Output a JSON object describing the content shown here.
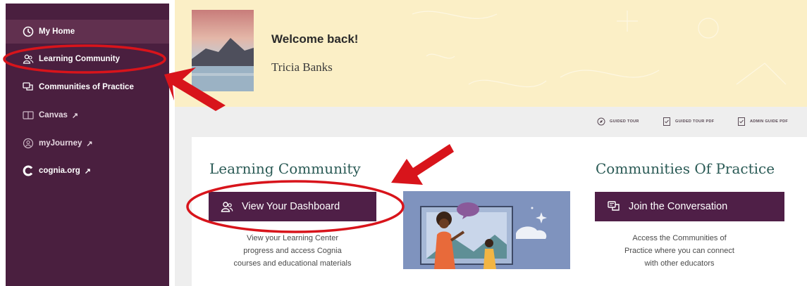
{
  "sidebar": {
    "items": [
      {
        "label": "My Home",
        "icon": "home-dial-icon",
        "external": false,
        "active": true
      },
      {
        "label": "Learning Community",
        "icon": "people-icon",
        "external": false,
        "active": false
      },
      {
        "label": "Communities of Practice",
        "icon": "chat-bubbles-icon",
        "external": false,
        "active": false
      },
      {
        "label": "Canvas",
        "icon": "book-icon",
        "external": true,
        "active": false
      },
      {
        "label": "myJourney",
        "icon": "journey-icon",
        "external": true,
        "active": false
      },
      {
        "label": "cognia.org",
        "icon": "cognia-logo-icon",
        "external": true,
        "active": false
      }
    ],
    "external_glyph": "↗"
  },
  "welcome": {
    "title": "Welcome back!",
    "name": "Tricia Banks"
  },
  "toolbar": {
    "items": [
      {
        "label": "GUIDED TOUR",
        "icon": "compass-icon"
      },
      {
        "label": "GUIDED TOUR PDF",
        "icon": "pdf-doc-icon"
      },
      {
        "label": "ADMIN GUIDE PDF",
        "icon": "pdf-doc-icon"
      }
    ]
  },
  "learning_community": {
    "title": "Learning Community",
    "button": "View Your Dashboard",
    "description_lines": [
      "View your Learning Center",
      "progress and access Cognia",
      "courses and educational materials"
    ]
  },
  "communities_of_practice": {
    "title": "Communities Of Practice",
    "button": "Join the Conversation",
    "description_lines": [
      "Access the Communities of",
      "Practice where you can connect",
      "with other educators"
    ]
  },
  "colors": {
    "sidebar": "#4a1f3f",
    "sidebar_active": "#61304f",
    "button": "#4f1f47",
    "banner": "#fbefc6",
    "heading": "#2a5a55",
    "annotation_red": "#d8141b"
  }
}
